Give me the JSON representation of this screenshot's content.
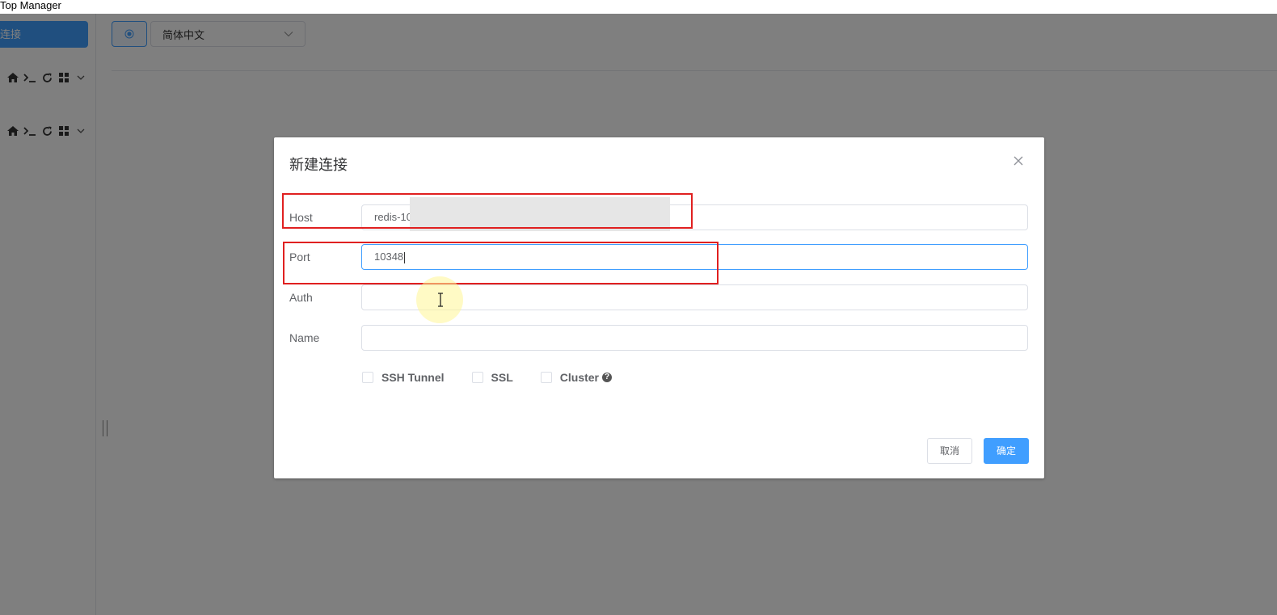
{
  "window": {
    "title": "Top Manager"
  },
  "sidebar": {
    "new_connection_label": "连接",
    "connections": [
      {
        "icons": [
          "home-icon",
          "terminal-icon",
          "refresh-icon",
          "grid-icon",
          "chevron-down-icon"
        ]
      },
      {
        "icons": [
          "home-icon",
          "terminal-icon",
          "refresh-icon",
          "grid-icon",
          "chevron-down-icon"
        ]
      }
    ]
  },
  "topbar": {
    "language_selected": "简体中文"
  },
  "dialog": {
    "title": "新建连接",
    "fields": {
      "host": {
        "label": "Host",
        "value": "redis-10"
      },
      "port": {
        "label": "Port",
        "value": "10348"
      },
      "auth": {
        "label": "Auth",
        "value": ""
      },
      "name": {
        "label": "Name",
        "value": ""
      }
    },
    "options": {
      "ssh_tunnel": "SSH Tunnel",
      "ssl": "SSL",
      "cluster": "Cluster"
    },
    "buttons": {
      "cancel": "取消",
      "confirm": "确定"
    }
  },
  "colors": {
    "accent": "#409eff",
    "overlay": "rgba(0,0,0,0.5)",
    "highlight_box": "#e02020"
  }
}
